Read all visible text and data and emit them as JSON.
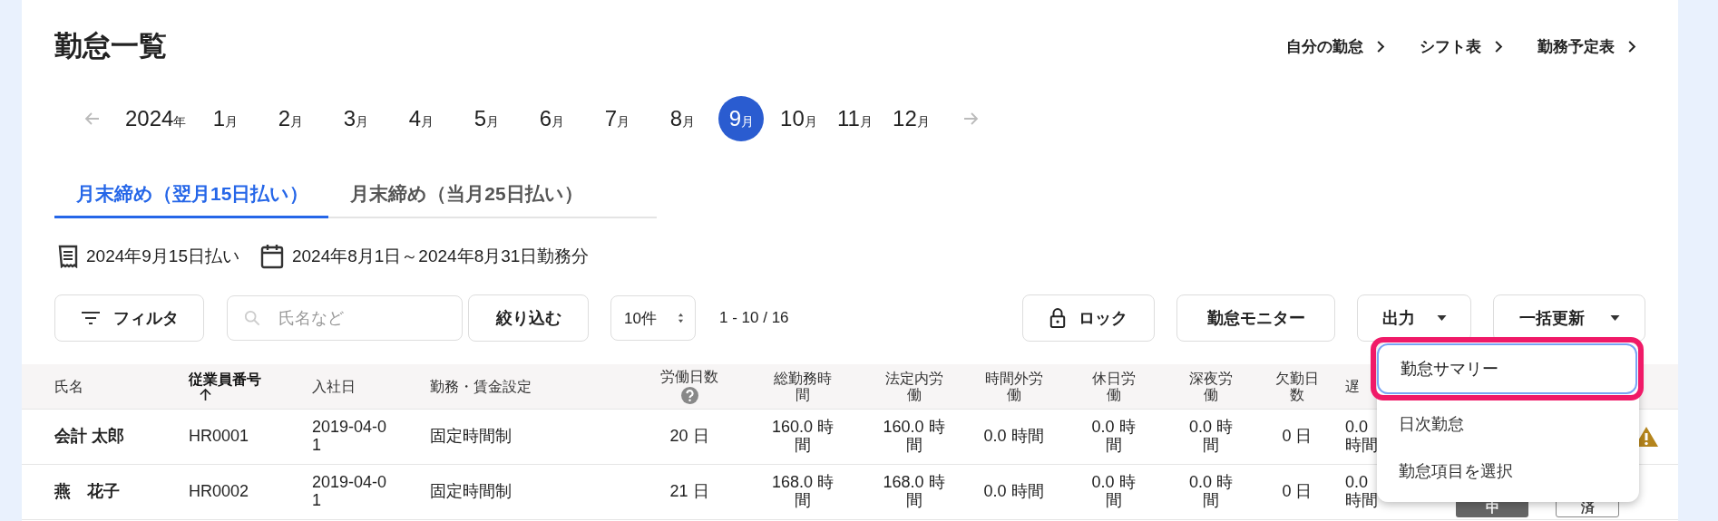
{
  "title": "勤怠一覧",
  "links": [
    "自分の勤怠",
    "シフト表",
    "勤務予定表"
  ],
  "year": {
    "number": "2024",
    "unit": "年"
  },
  "months": [
    {
      "number": "1",
      "unit": "月",
      "selected": false
    },
    {
      "number": "2",
      "unit": "月",
      "selected": false
    },
    {
      "number": "3",
      "unit": "月",
      "selected": false
    },
    {
      "number": "4",
      "unit": "月",
      "selected": false
    },
    {
      "number": "5",
      "unit": "月",
      "selected": false
    },
    {
      "number": "6",
      "unit": "月",
      "selected": false
    },
    {
      "number": "7",
      "unit": "月",
      "selected": false
    },
    {
      "number": "8",
      "unit": "月",
      "selected": false
    },
    {
      "number": "9",
      "unit": "月",
      "selected": true
    },
    {
      "number": "10",
      "unit": "月",
      "selected": false
    },
    {
      "number": "11",
      "unit": "月",
      "selected": false
    },
    {
      "number": "12",
      "unit": "月",
      "selected": false
    }
  ],
  "tabs": [
    {
      "label": "月末締め（翌月15日払い）",
      "selected": true
    },
    {
      "label": "月末締め（当月25日払い）",
      "selected": false
    }
  ],
  "pay_date": "2024年9月15日払い",
  "work_period": "2024年8月1日～2024年8月31日勤務分",
  "filter_button": "フィルタ",
  "search": {
    "placeholder": "氏名など"
  },
  "narrow_button": "絞り込む",
  "page_size": "10件",
  "range": "1 - 10 / 16",
  "lock_button": "ロック",
  "monitor_button": "勤怠モニター",
  "output_button": "出力",
  "bulk_button": "一括更新",
  "columns": [
    {
      "label": "氏名",
      "sorted": false,
      "help": false
    },
    {
      "label": "従業員番号",
      "sorted": true,
      "help": false
    },
    {
      "label": "入社日",
      "sorted": false,
      "help": false
    },
    {
      "label": "勤務・賃金設定",
      "sorted": false,
      "help": false
    },
    {
      "label": "労働日数",
      "sorted": false,
      "help": true
    },
    {
      "label": "総勤務時間",
      "sorted": false,
      "help": false
    },
    {
      "label": "法定内労働",
      "sorted": false,
      "help": false
    },
    {
      "label": "時間外労働",
      "sorted": false,
      "help": false
    },
    {
      "label": "休日労働",
      "sorted": false,
      "help": false
    },
    {
      "label": "深夜労働",
      "sorted": false,
      "help": false
    },
    {
      "label": "欠勤日数",
      "sorted": false,
      "help": false
    },
    {
      "label": "遅",
      "sorted": false,
      "help": false
    }
  ],
  "rows": [
    {
      "cells": [
        "会計 太郎",
        "HR0001",
        "2019-04-01",
        "固定時間制",
        "20 日",
        "160.0 時間",
        "160.0 時間",
        "0.0 時間",
        "0.0 時間",
        "0.0 時間",
        "0 日",
        "0.0 時間"
      ],
      "badges": [],
      "warning": true
    },
    {
      "cells": [
        "燕　花子",
        "HR0002",
        "2019-04-01",
        "固定時間制",
        "21 日",
        "168.0 時間",
        "168.0 時間",
        "0.0 時間",
        "0.0 時間",
        "0.0 時間",
        "0 日",
        "0.0 時間"
      ],
      "badges": [
        {
          "label": "中",
          "kind": "filled"
        },
        {
          "label": "済",
          "kind": "outline"
        }
      ],
      "warning": false
    }
  ],
  "menu": {
    "items": [
      {
        "label": "勤怠サマリー",
        "selected": true
      },
      {
        "label": "日次勤怠",
        "selected": false
      },
      {
        "label": "勤怠項目を選択",
        "selected": false
      }
    ]
  }
}
